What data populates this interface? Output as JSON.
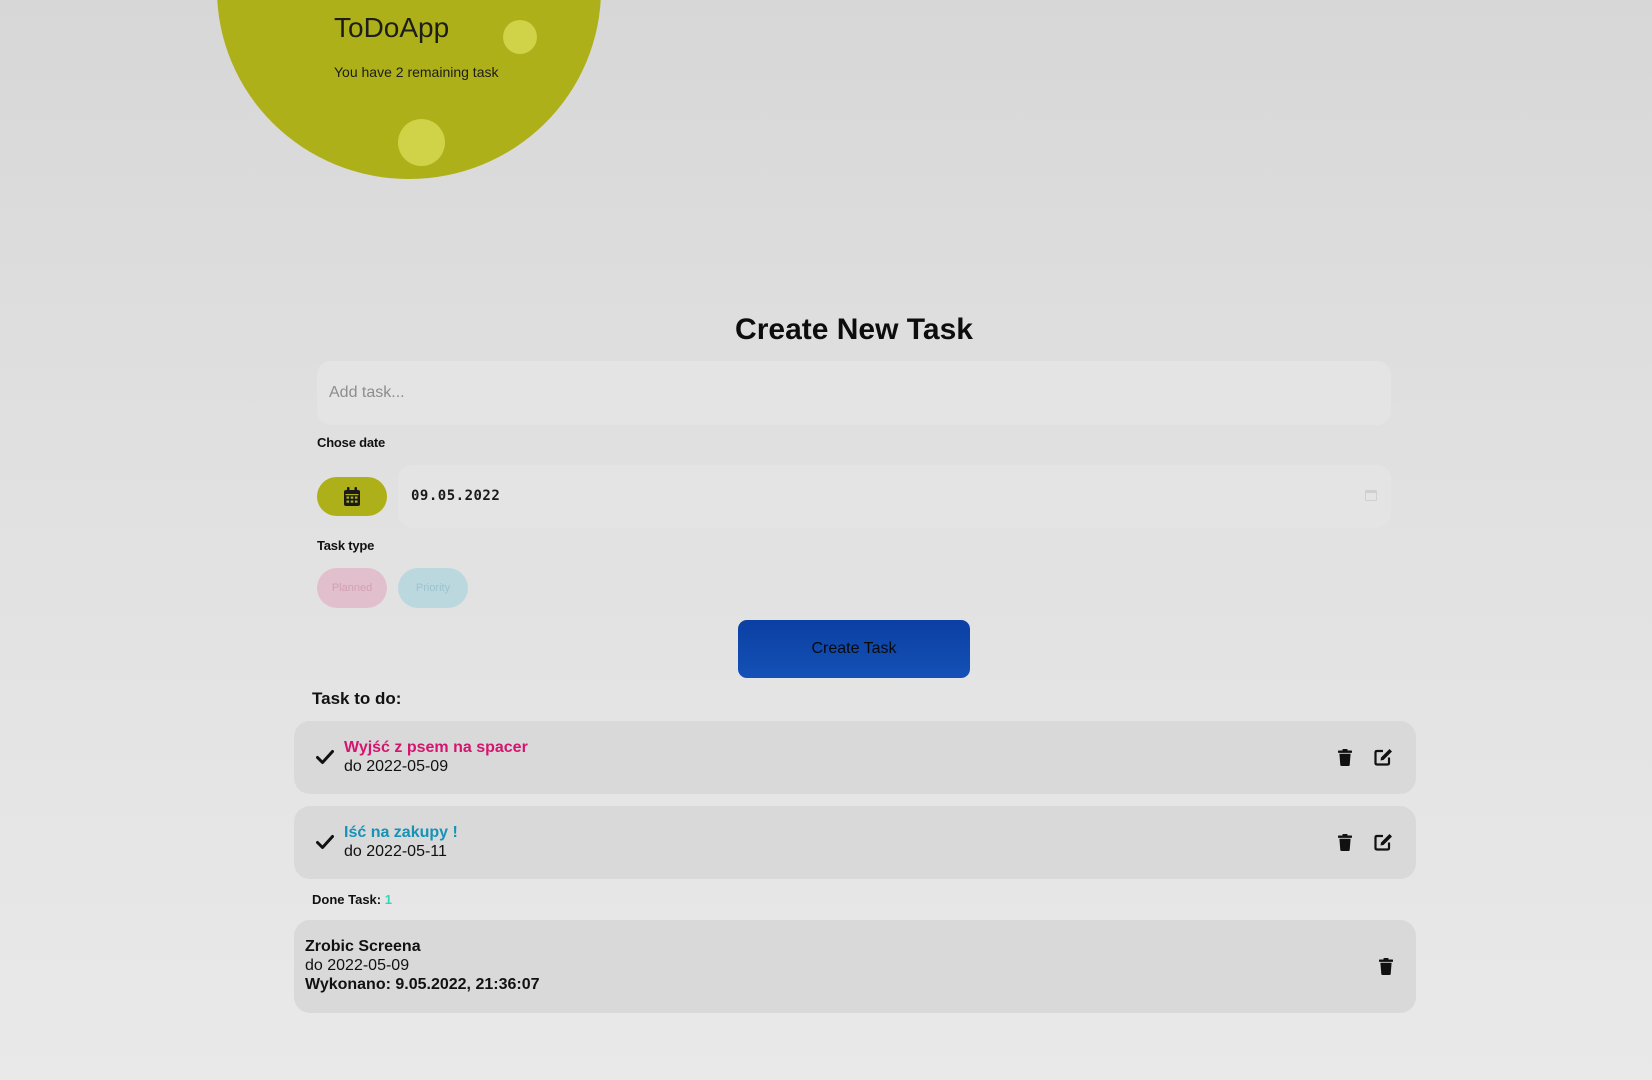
{
  "app": {
    "title": "ToDoApp",
    "subtitle": "You have 2 remaining task"
  },
  "form": {
    "heading": "Create New Task",
    "task_placeholder": "Add task...",
    "date_label": "Chose date",
    "date_value": "09.05.2022",
    "type_label": "Task type",
    "types": [
      "Planned",
      "Priority"
    ],
    "create_label": "Create Task"
  },
  "todo": {
    "title": "Task to do:",
    "items": [
      {
        "title": "Wyjść z psem na spacer",
        "due": "do 2022-05-09",
        "color": "#d6146f"
      },
      {
        "title": "Iść na zakupy !",
        "due": "do 2022-05-11",
        "color": "#1792b5"
      }
    ]
  },
  "done": {
    "label": "Done Task:",
    "count": "1",
    "count_color": "#33d6b4",
    "items": [
      {
        "title": "Zrobic Screena",
        "due": "do 2022-05-09",
        "completed": "Wykonano: 9.05.2022, 21:36:07"
      }
    ]
  },
  "colors": {
    "accent": "#adb018",
    "button": "#0b3fa3"
  },
  "icons": {
    "calendar": "calendar-icon",
    "check": "check-icon",
    "trash": "trash-icon",
    "edit": "edit-icon"
  }
}
